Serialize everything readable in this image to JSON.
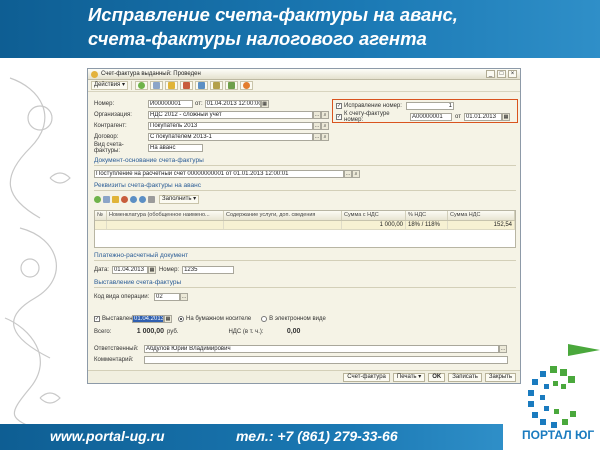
{
  "slide": {
    "title": "Исправление счета-фактуры на аванс,\nсчета-фактуры налогового агента",
    "footer_site": "www.portal-ug.ru",
    "footer_phone": "тел.: +7 (861) 279-33-66",
    "logo_text": "ПОРТАЛ ЮГ"
  },
  "window": {
    "title": "Счет-фактура выданный: Проведен",
    "close_glyph": "×",
    "min_glyph": "_",
    "max_glyph": "□",
    "actions_label": "Действия ▾"
  },
  "fields": {
    "number_label": "Номер:",
    "number_value": "И00000001",
    "from_label": "от:",
    "date_value": "01.04.2013 12:00:00",
    "org_label": "Организация:",
    "org_value": "НДС 2012 - сложный учет",
    "contractor_label": "Контрагент:",
    "contractor_value": "Покупатель 2013",
    "contract_label": "Договор:",
    "contract_value": "С покупателем 2013-1",
    "type_label": "Вид счета-фактуры:",
    "type_value": "На аванс",
    "correction_label": "Исправление номер:",
    "correction_value": "1",
    "to_invoice_label": "К счету-фактуре номер:",
    "to_invoice_value": "А00000001",
    "to_invoice_from": "от",
    "to_invoice_date": "01.01.2013"
  },
  "basis": {
    "section": "Документ-основание счета-фактуры",
    "value": "Поступление на расчетный счет 00000000001 от 01.01.2013 12:00:01"
  },
  "requisites": {
    "section": "Реквизиты счета-фактуры на аванс",
    "fill_label": "Заполнить ▾",
    "columns": [
      "№",
      "Номенклатура (обобщенное наимено...",
      "Содержание услуги, доп. сведения",
      "Сумма с НДС",
      "% НДС",
      "Сумма НДС"
    ],
    "rows": [
      [
        "",
        "",
        "",
        "1 000,00",
        "18% / 118%",
        "152,54"
      ]
    ]
  },
  "payment": {
    "section": "Платежно-расчетный документ",
    "date_label": "Дата:",
    "date_value": "01.04.2013",
    "number_label": "Номер:",
    "number_value": "1235"
  },
  "issue": {
    "section": "Выставление счета-фактуры",
    "op_code_label": "Код вида операции:",
    "op_code_value": "02",
    "issued_label": "Выставлен",
    "issued_date": "01.04.2013",
    "paper_label": "На бумажном носителе",
    "electronic_label": "В электронном виде",
    "total_label": "Всего:",
    "total_value": "1 000,00",
    "currency": "руб.",
    "vat_label": "НДС (в т. ч.):",
    "vat_value": "0,00",
    "responsible_label": "Ответственный:",
    "responsible_value": "Абдулов Юрий Владимирович",
    "comment_label": "Комментарий:",
    "comment_value": ""
  },
  "bottom": {
    "invoice_btn": "Счет-фактура",
    "print_btn": "Печать ▾",
    "ok_btn": "OK",
    "save_btn": "Записать",
    "close_btn": "Закрыть"
  },
  "colors": {
    "header_blue": "#1b79b4",
    "highlight_orange": "#d9531e",
    "section_text": "#2a5c96",
    "logo_blue": "#1a7bbf",
    "logo_green": "#4aa83c"
  }
}
